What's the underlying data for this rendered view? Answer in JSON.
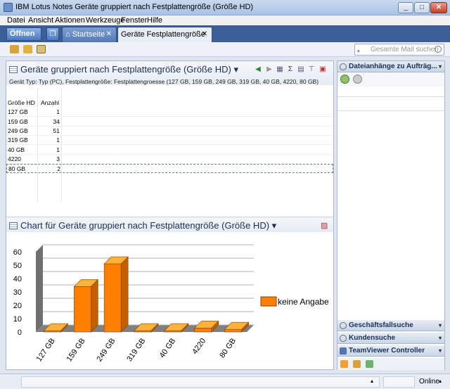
{
  "window": {
    "title": "IBM Lotus Notes Geräte gruppiert nach Festplattengröße (Größe HD)",
    "min": "_",
    "max": "□",
    "close": "✕"
  },
  "menu": [
    "Datei",
    "Ansicht",
    "Aktionen",
    "Werkzeuge",
    "Fenster",
    "Hilfe"
  ],
  "tabs": {
    "open_label": "Öffnen ⇣",
    "home_label": "Startseite",
    "active_label": "Geräte Festplattengröße",
    "close": "✕"
  },
  "toolbar": {
    "search_placeholder": "Gesamte Mail suchen"
  },
  "view": {
    "title": "Geräte gruppiert nach Festplattengröße (Größe HD) ▾",
    "subtitle": "Gerät Typ: Typ (PC), Festplattengröße: Festplattengroesse (127 GB, 159 GB, 249 GB, 319 GB, 40 GB, 4220, 80 GB)",
    "columns": [
      "Größe HD",
      "Anzahl"
    ],
    "rows": [
      {
        "size": "127 GB",
        "count": "1"
      },
      {
        "size": "159 GB",
        "count": "34"
      },
      {
        "size": "249 GB",
        "count": "51"
      },
      {
        "size": "319 GB",
        "count": "1"
      },
      {
        "size": "40 GB",
        "count": "1"
      },
      {
        "size": "4220",
        "count": "3"
      },
      {
        "size": "80 GB",
        "count": "2"
      }
    ]
  },
  "chart_header": {
    "title": "Chart für Geräte gruppiert nach Festplattengröße (Größe HD) ▾"
  },
  "chart_data": {
    "type": "bar",
    "categories": [
      "127 GB",
      "159 GB",
      "249 GB",
      "319 GB",
      "40 GB",
      "4220",
      "80 GB"
    ],
    "series": [
      {
        "name": "keine Angabe",
        "values": [
          1,
          34,
          51,
          1,
          1,
          3,
          2
        ],
        "color": "#ff8000"
      }
    ],
    "ylim": [
      0,
      60
    ],
    "yticks": [
      "0",
      "10",
      "20",
      "30",
      "40",
      "50",
      "60"
    ],
    "grid": true,
    "legend": "right"
  },
  "right_panel": {
    "attachments": "Dateianhänge zu Aufträg...",
    "sections": [
      "Geschäftsfallsuche",
      "Kundensuche",
      "TeamViewer Controller"
    ]
  },
  "status": {
    "online": "Online"
  }
}
